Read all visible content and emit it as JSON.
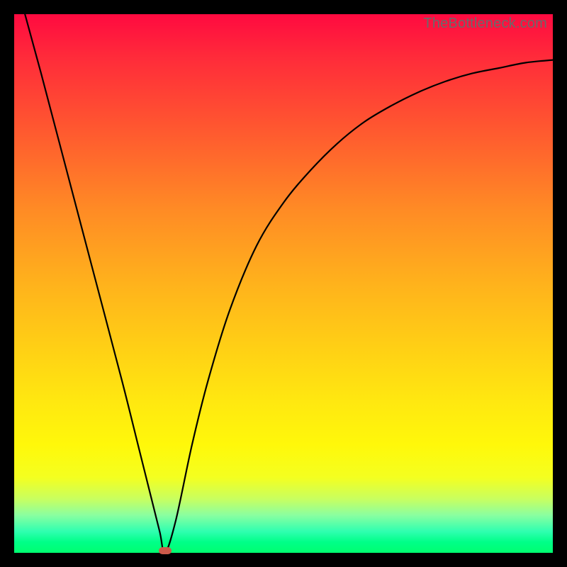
{
  "watermark": "TheBottleneck.com",
  "colors": {
    "frame_bg_top": "#ff0a40",
    "frame_bg_bottom": "#00ff70",
    "page_bg": "#000000",
    "curve_stroke": "#000000",
    "marker_fill": "#cc5a4a",
    "watermark_text": "#6a6a6a"
  },
  "chart_data": {
    "type": "line",
    "title": "",
    "xlabel": "",
    "ylabel": "",
    "xlim": [
      0,
      100
    ],
    "ylim": [
      0,
      100
    ],
    "grid": false,
    "legend": false,
    "series": [
      {
        "name": "curve",
        "x": [
          2,
          5,
          10,
          15,
          20,
          23,
          25,
          27,
          28,
          30,
          33,
          36,
          40,
          45,
          50,
          55,
          60,
          65,
          70,
          75,
          80,
          85,
          90,
          95,
          100
        ],
        "y": [
          100,
          89,
          70,
          51,
          32,
          20,
          12,
          4,
          0,
          6,
          20,
          32,
          45,
          57,
          65,
          71,
          76,
          80,
          83,
          85.5,
          87.5,
          89,
          90,
          91,
          91.5
        ]
      }
    ],
    "minimum_marker": {
      "x": 28,
      "y": 0
    },
    "notes": "y-axis represents vertical position of the black curve within the gradient plot area; 0 = bottom (green) edge, 100 = top (red) edge. The curve dips to 0 near x≈28 then asymptotically rises toward ~92."
  }
}
